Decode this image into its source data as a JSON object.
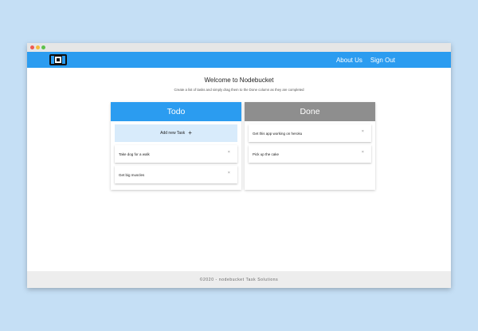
{
  "window": {
    "traffic_lights": [
      "red",
      "yellow",
      "green"
    ]
  },
  "navbar": {
    "logo_icon": "nodebucket-logo-icon",
    "links": [
      "About Us",
      "Sign Out"
    ]
  },
  "main": {
    "title": "Welcome to Nodebucket",
    "subtitle": "Create a list of tasks and simply drag them to the Done column as they are completed"
  },
  "todo": {
    "header": "Todo",
    "add_label": "Add new Task",
    "add_icon": "+",
    "tasks": [
      "Take dog for a walk",
      "Get big muscles"
    ]
  },
  "done": {
    "header": "Done",
    "tasks": [
      "Get this app working on heroku",
      "Pick up the cake"
    ]
  },
  "card_close_icon": "×",
  "footer": {
    "text": "©2020 - nodebucket Task Solutions"
  },
  "colors": {
    "primary": "#2b9cf0",
    "done_header": "#8e8e8e",
    "add_task_bg": "#d8ebfb",
    "background": "#c5dff5"
  }
}
